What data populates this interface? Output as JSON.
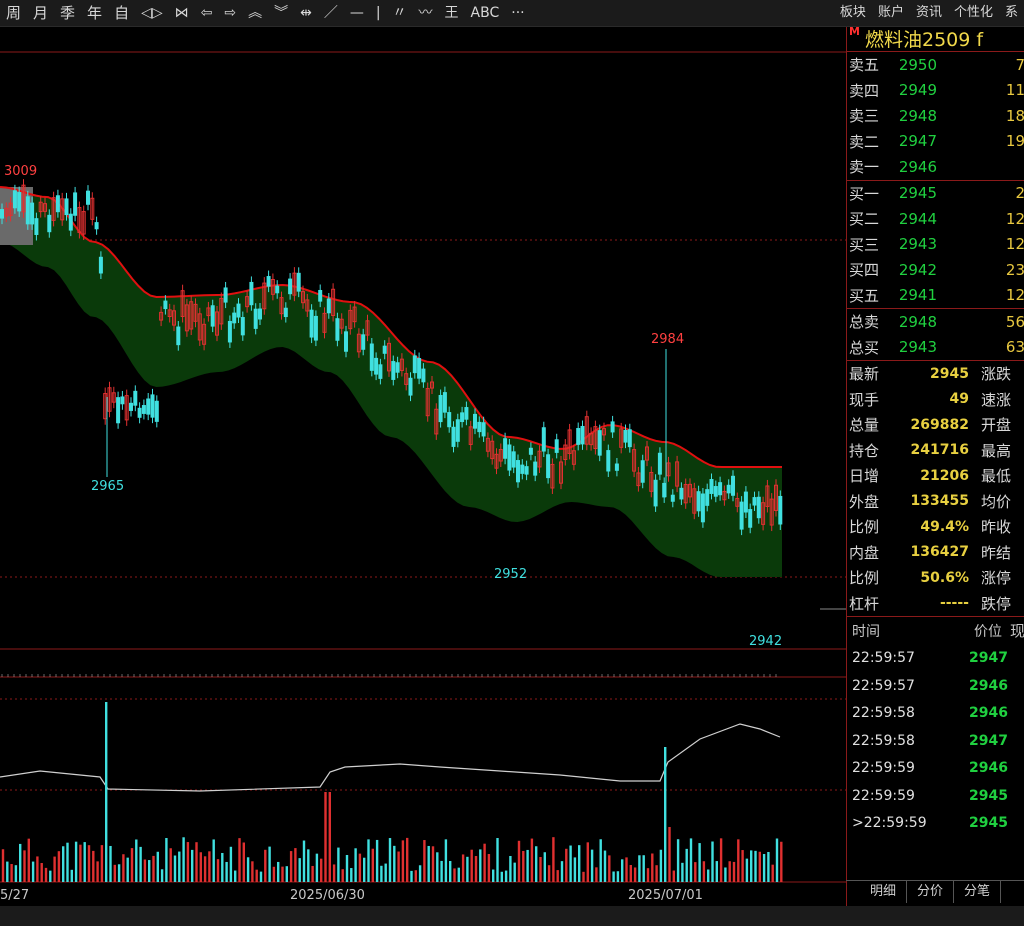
{
  "toolbar": {
    "items": [
      "周",
      "月",
      "季",
      "年",
      "自",
      "◁▷",
      "⋈",
      "⇦",
      "⇨",
      "︽",
      "︾",
      "⇹",
      "／",
      "—",
      "|",
      "〃",
      "〰",
      "王",
      "ABC",
      "···"
    ],
    "right": [
      "板块",
      "账户",
      "资讯",
      "个性化",
      "系"
    ]
  },
  "chart": {
    "price_labels": {
      "high_left": "3009",
      "low_left": "2965",
      "high_mid": "2984",
      "low_mid": "2952",
      "low_right": "2942"
    },
    "date_labels": [
      "5/27",
      "2025/06/30",
      "2025/07/01"
    ]
  },
  "panel": {
    "flag": "M",
    "title": "燃料油2509  f",
    "asks": [
      {
        "label": "卖五",
        "price": "2950",
        "vol": "7"
      },
      {
        "label": "卖四",
        "price": "2949",
        "vol": "11"
      },
      {
        "label": "卖三",
        "price": "2948",
        "vol": "18"
      },
      {
        "label": "卖二",
        "price": "2947",
        "vol": "19"
      },
      {
        "label": "卖一",
        "price": "2946",
        "vol": ""
      }
    ],
    "bids": [
      {
        "label": "买一",
        "price": "2945",
        "vol": "2"
      },
      {
        "label": "买二",
        "price": "2944",
        "vol": "12"
      },
      {
        "label": "买三",
        "price": "2943",
        "vol": "12"
      },
      {
        "label": "买四",
        "price": "2942",
        "vol": "23"
      },
      {
        "label": "买五",
        "price": "2941",
        "vol": "12"
      }
    ],
    "totals": [
      {
        "label": "总卖",
        "price": "2948",
        "vol": "56"
      },
      {
        "label": "总买",
        "price": "2943",
        "vol": "63"
      }
    ],
    "stats": [
      {
        "l1": "最新",
        "v": "2945",
        "l2": "涨跌"
      },
      {
        "l1": "现手",
        "v": "49",
        "l2": "速涨"
      },
      {
        "l1": "总量",
        "v": "269882",
        "l2": "开盘"
      },
      {
        "l1": "持仓",
        "v": "241716",
        "l2": "最高"
      },
      {
        "l1": "日增",
        "v": "21206",
        "l2": "最低"
      },
      {
        "l1": "外盘",
        "v": "133455",
        "l2": "均价"
      },
      {
        "l1": "比例",
        "v": "49.4%",
        "l2": "昨收"
      },
      {
        "l1": "内盘",
        "v": "136427",
        "l2": "昨结"
      },
      {
        "l1": "比例",
        "v": "50.6%",
        "l2": "涨停"
      },
      {
        "l1": "杠杆",
        "v": "-----",
        "l2": "跌停"
      }
    ],
    "tick_header": {
      "time": "时间",
      "price": "价位",
      "vol": "现"
    },
    "ticks": [
      {
        "time": "22:59:57",
        "price": "2947"
      },
      {
        "time": "22:59:57",
        "price": "2946"
      },
      {
        "time": "22:59:58",
        "price": "2946"
      },
      {
        "time": "22:59:58",
        "price": "2947"
      },
      {
        "time": "22:59:59",
        "price": "2946"
      },
      {
        "time": "22:59:59",
        "price": "2945"
      },
      {
        "time": ">22:59:59",
        "price": "2945"
      }
    ],
    "tabs": [
      "明细",
      "分价",
      "分笔"
    ]
  }
}
